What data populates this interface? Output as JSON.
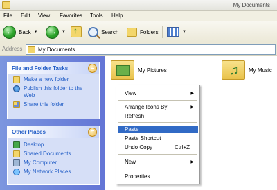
{
  "window": {
    "title": "My Documents"
  },
  "menubar": {
    "items": [
      "File",
      "Edit",
      "View",
      "Favorites",
      "Tools",
      "Help"
    ]
  },
  "toolbar": {
    "back_label": "Back",
    "search_label": "Search",
    "folders_label": "Folders"
  },
  "address": {
    "label": "Address",
    "value": "My Documents"
  },
  "tasks_panel": {
    "title": "File and Folder Tasks",
    "items": [
      "Make a new folder",
      "Publish this folder to the Web",
      "Share this folder"
    ]
  },
  "places_panel": {
    "title": "Other Places",
    "items": [
      "Desktop",
      "Shared Documents",
      "My Computer",
      "My Network Places"
    ]
  },
  "folders": [
    "My Pictures",
    "My Music"
  ],
  "context_menu": {
    "items": [
      {
        "label": "View",
        "submenu": true
      },
      {
        "label": "Arrange Icons By",
        "submenu": true
      },
      {
        "label": "Refresh"
      },
      {
        "label": "Paste",
        "selected": true
      },
      {
        "label": "Paste Shortcut"
      },
      {
        "label": "Undo Copy",
        "shortcut": "Ctrl+Z"
      },
      {
        "label": "New",
        "submenu": true
      },
      {
        "label": "Properties"
      }
    ]
  },
  "colors": {
    "selection": "#316ac5",
    "link": "#215dc6",
    "taskpane": "#6375d6"
  }
}
